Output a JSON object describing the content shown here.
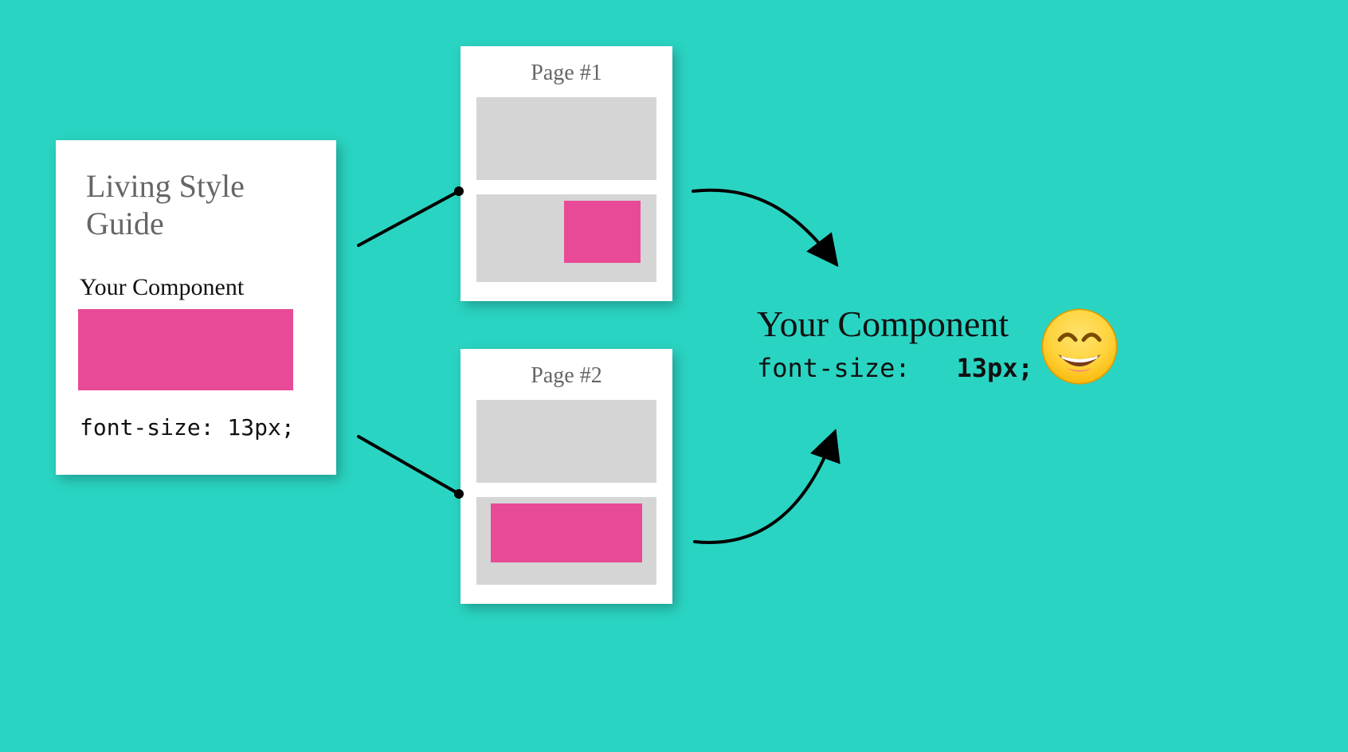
{
  "style_guide": {
    "title": "Living Style Guide",
    "component_label": "Your Component",
    "css_snippet": "font-size: 13px;",
    "swatch_color": "#e94a97"
  },
  "pages": [
    {
      "title": "Page #1"
    },
    {
      "title": "Page #2"
    }
  ],
  "result": {
    "title": "Your Component",
    "css_prop": "font-size:",
    "css_value": "13px;",
    "emoji_name": "grinning-face-with-smiling-eyes"
  },
  "colors": {
    "background": "#2ad4c2",
    "pink": "#e94a97",
    "grey_block": "#d5d5d5"
  }
}
